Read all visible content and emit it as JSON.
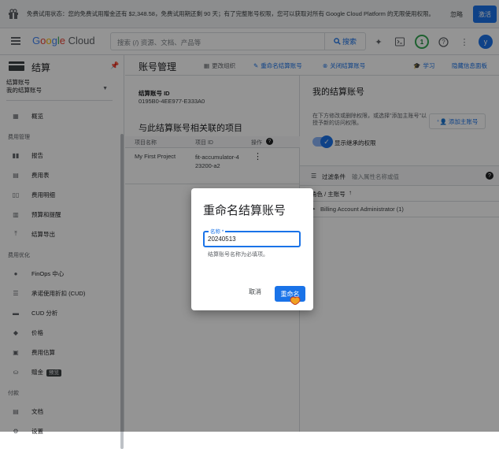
{
  "banner": {
    "text": "免费试用状态：您的免费试用赠金还有 $2,348.58，免费试用期还剩 90 天；有了完整账号权限，您可以获取对所有 Google Cloud Platform 的无限使用权限。",
    "dismiss": "忽略",
    "activate": "激活"
  },
  "topbar": {
    "logo_google": "Google",
    "logo_cloud": "Cloud",
    "search_placeholder": "搜索 (/) 资源、文档、产品等",
    "search_button": "搜索",
    "notification_count": "1",
    "avatar_letter": "y"
  },
  "sidebar": {
    "title": "结算",
    "account_label": "结算账号",
    "account_value": "我的结算账号",
    "items": [
      {
        "label": "概览",
        "icon": "overview-icon"
      },
      {
        "section": "费用管理"
      },
      {
        "label": "报告",
        "icon": "reports-icon"
      },
      {
        "label": "费用表",
        "icon": "cost-table-icon"
      },
      {
        "label": "费用明细",
        "icon": "cost-breakdown-icon"
      },
      {
        "label": "预算和提醒",
        "icon": "budget-icon"
      },
      {
        "label": "结算导出",
        "icon": "export-icon"
      },
      {
        "section": "费用优化"
      },
      {
        "label": "FinOps 中心",
        "icon": "finops-icon"
      },
      {
        "label": "承诺使用折扣 (CUD)",
        "icon": "cud-icon"
      },
      {
        "label": "CUD 分析",
        "icon": "cud-analysis-icon"
      },
      {
        "label": "价格",
        "icon": "pricing-icon"
      },
      {
        "label": "费用估算",
        "icon": "estimate-icon"
      },
      {
        "label": "赠金",
        "icon": "credits-icon",
        "badge": "预览"
      },
      {
        "section": "付款"
      },
      {
        "label": "文档",
        "icon": "documents-icon"
      },
      {
        "label": "设置",
        "icon": "settings-icon"
      }
    ]
  },
  "main": {
    "title": "账号管理",
    "actions": {
      "change_org": "更改组织",
      "rename": "重命名结算账号",
      "close": "关闭结算账号",
      "learn": "学习",
      "hide_panel": "隐藏信息面板"
    },
    "account_id_label": "结算账号 ID",
    "account_id": "0195B0-4EE977-E333A0",
    "projects_heading": "与此结算账号相关联的项目",
    "table": {
      "headers": [
        "项目名称",
        "项目 ID",
        "操作"
      ],
      "rows": [
        {
          "name": "My First Project",
          "id": "fit-accumulator-423200-a2"
        }
      ]
    }
  },
  "right_panel": {
    "title": "我的结算账号",
    "description": "在下方修改或删除权限，或选择\"添加主账号\"以授予新的访问权限。",
    "add_principal": "添加主账号",
    "show_inherited": "显示继承的权限",
    "filter_label": "过滤条件",
    "filter_placeholder": "输入属性名称或值",
    "column": "角色 / 主账号",
    "row": "Billing Account Administrator (1)"
  },
  "dialog": {
    "title": "重命名结算账号",
    "field_label": "名称 *",
    "field_value": "20240513",
    "hint": "结算账号名称为必填项。",
    "cancel": "取消",
    "confirm": "重命名"
  },
  "colors": {
    "accent": "#1a73e8",
    "green": "#34a853"
  }
}
